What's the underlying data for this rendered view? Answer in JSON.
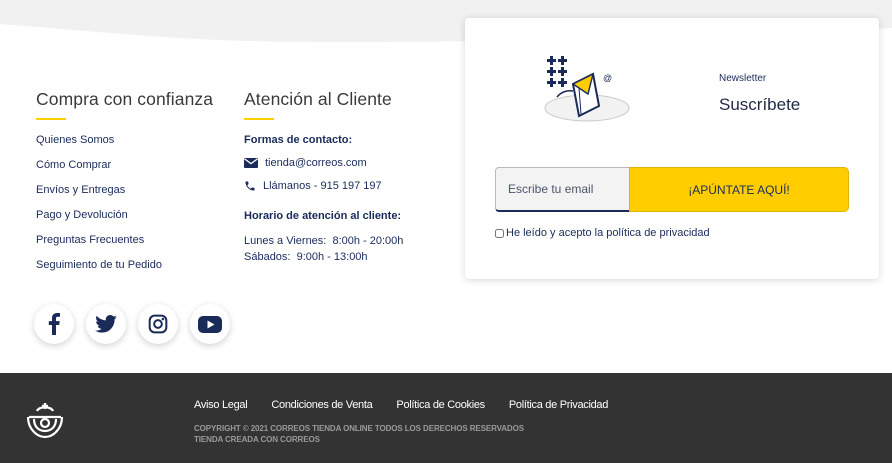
{
  "colors": {
    "accent": "#ffcd00",
    "navy": "#1a2b5a",
    "footer_bg": "#333333"
  },
  "trust": {
    "title": "Compra con confianza",
    "links": [
      "Quienes Somos",
      "Cómo Comprar",
      "Envíos y Entregas",
      "Pago y Devolución",
      "Preguntas Frecuentes",
      "Seguimiento de tu Pedido"
    ]
  },
  "support": {
    "title": "Atención al Cliente",
    "contact_heading": "Formas de contacto:",
    "email": "tienda@correos.com",
    "phone": "Llámanos - 915 197 197",
    "hours_heading": "Horario de atención al cliente:",
    "hours": [
      "Lunes a Viernes:  8:00h - 20:00h",
      "Sábados:  9:00h - 13:00h"
    ]
  },
  "social": [
    "facebook-icon",
    "twitter-icon",
    "instagram-icon",
    "youtube-icon"
  ],
  "newsletter": {
    "label": "Newsletter",
    "title": "Suscríbete",
    "email_placeholder": "Escribe tu email",
    "button": "¡APÚNTATE AQUÍ!",
    "privacy": "He leído y acepto la política de privacidad"
  },
  "footer": {
    "links": [
      "Aviso Legal",
      "Condiciones de Venta",
      "Política de Cookies",
      "Política de Privacidad"
    ],
    "copyright": "COPYRIGHT © 2021 CORREOS TIENDA ONLINE TODOS LOS DERECHOS RESERVADOS",
    "created": "TIENDA CREADA CON CORREOS"
  }
}
